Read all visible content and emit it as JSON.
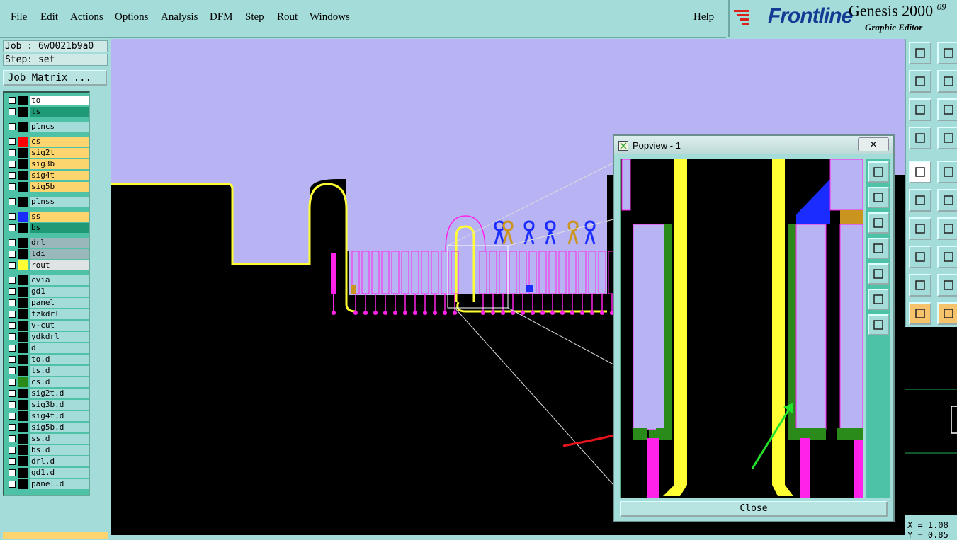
{
  "menu": {
    "items": [
      "File",
      "Edit",
      "Actions",
      "Options",
      "Analysis",
      "DFM",
      "Step",
      "Rout",
      "Windows"
    ],
    "help": "Help"
  },
  "brand": {
    "logo": "Frontline",
    "product": "Genesis 2000",
    "version_sup": "09",
    "subtitle": "Graphic Editor"
  },
  "job": {
    "job_line": "Job : 6w0021b9a0",
    "step_line": "Step: set",
    "matrix_button": "Job Matrix ..."
  },
  "layers": [
    {
      "name": "to",
      "color": "#ffffff",
      "swatch": "#000000"
    },
    {
      "name": "ts",
      "color": "#1f9a77",
      "swatch": "#000000"
    },
    {
      "name": "plncs",
      "color": "#a3dcd8",
      "swatch": "#000000"
    },
    {
      "name": "cs",
      "color": "#fcd56e",
      "swatch": "#ff0000"
    },
    {
      "name": "sig2t",
      "color": "#fcd56e",
      "swatch": "#000000"
    },
    {
      "name": "sig3b",
      "color": "#fcd56e",
      "swatch": "#000000"
    },
    {
      "name": "sig4t",
      "color": "#fcd56e",
      "swatch": "#000000"
    },
    {
      "name": "sig5b",
      "color": "#fcd56e",
      "swatch": "#000000"
    },
    {
      "name": "plnss",
      "color": "#a3dcd8",
      "swatch": "#000000"
    },
    {
      "name": "ss",
      "color": "#fcd56e",
      "swatch": "#1a2cff"
    },
    {
      "name": "bs",
      "color": "#1f9a77",
      "swatch": "#000000"
    },
    {
      "name": "drl",
      "color": "#9ab7bb",
      "swatch": "#000000"
    },
    {
      "name": "ldi",
      "color": "#9ab7bb",
      "swatch": "#000000"
    },
    {
      "name": "rout",
      "color": "#dfe3e3",
      "swatch": "#ffff33"
    },
    {
      "name": "cvia",
      "color": "#a3dcd8",
      "swatch": "#000000"
    },
    {
      "name": "gd1",
      "color": "#a3dcd8",
      "swatch": "#000000"
    },
    {
      "name": "panel",
      "color": "#a3dcd8",
      "swatch": "#000000"
    },
    {
      "name": "fzkdrl",
      "color": "#a3dcd8",
      "swatch": "#000000"
    },
    {
      "name": "v-cut",
      "color": "#a3dcd8",
      "swatch": "#000000"
    },
    {
      "name": "ydkdrl",
      "color": "#a3dcd8",
      "swatch": "#000000"
    },
    {
      "name": "d",
      "color": "#a3dcd8",
      "swatch": "#000000"
    },
    {
      "name": "to.d",
      "color": "#a3dcd8",
      "swatch": "#000000"
    },
    {
      "name": "ts.d",
      "color": "#a3dcd8",
      "swatch": "#000000"
    },
    {
      "name": "cs.d",
      "color": "#a3dcd8",
      "swatch": "#2a8a1a"
    },
    {
      "name": "sig2t.d",
      "color": "#a3dcd8",
      "swatch": "#000000"
    },
    {
      "name": "sig3b.d",
      "color": "#a3dcd8",
      "swatch": "#000000"
    },
    {
      "name": "sig4t.d",
      "color": "#a3dcd8",
      "swatch": "#000000"
    },
    {
      "name": "sig5b.d",
      "color": "#a3dcd8",
      "swatch": "#000000"
    },
    {
      "name": "ss.d",
      "color": "#a3dcd8",
      "swatch": "#000000"
    },
    {
      "name": "bs.d",
      "color": "#a3dcd8",
      "swatch": "#000000"
    },
    {
      "name": "drl.d",
      "color": "#a3dcd8",
      "swatch": "#000000"
    },
    {
      "name": "gd1.d",
      "color": "#a3dcd8",
      "swatch": "#000000"
    },
    {
      "name": "panel.d",
      "color": "#a3dcd8",
      "swatch": "#000000"
    }
  ],
  "popview": {
    "title": "Popview - 1",
    "close_label": "Close",
    "close_x": "✕"
  },
  "coords": {
    "x_line": "X = 1.08",
    "y_line": "Y = 0.85"
  },
  "colors": {
    "background": "#a3dcd8",
    "canvas_bg": "#000000",
    "lavender": "#b8b4f4",
    "magenta": "#ff22e8",
    "yellow": "#ffff33",
    "green": "#2a8a1a",
    "blue": "#1a2cff",
    "gold": "#c9951e"
  },
  "icons": {
    "toolbar": [
      "move-up-icon",
      "move-down-icon",
      "move-left-icon",
      "move-right-icon",
      "fit-screen-icon",
      "zoom-fit-icon",
      "settings-wrench-icon",
      "grid-icon",
      "pad-select-icon",
      "line-draw-icon",
      "connect-icon",
      "cross-icon",
      "slope-line-icon",
      "slope-line-red-icon",
      "shape-snap-icon",
      "horizontal-line-icon",
      "triangle-icon",
      "triangle-outline-icon",
      "pointer-icon",
      "pointer-selected-icon"
    ],
    "popview_tools": [
      "pv-zoom-icon",
      "pv-up-icon",
      "pv-down-icon",
      "pv-left-icon",
      "pv-right-icon",
      "pv-expand-icon",
      "pv-fit-icon"
    ]
  }
}
